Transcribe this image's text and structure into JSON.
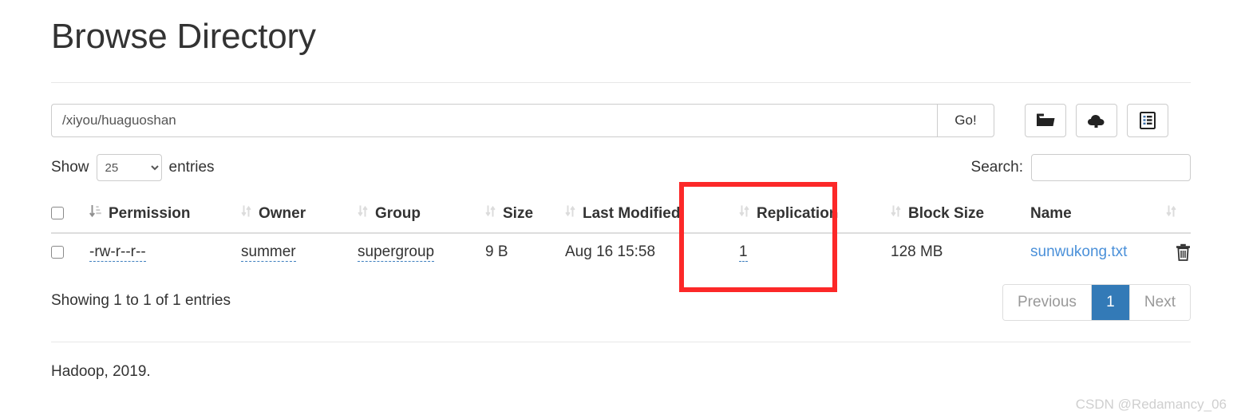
{
  "page": {
    "title": "Browse Directory"
  },
  "path_bar": {
    "value": "/xiyou/huaguoshan",
    "placeholder": "",
    "go_label": "Go!",
    "buttons": [
      {
        "name": "create-directory-button",
        "icon": "folder-open-icon"
      },
      {
        "name": "upload-files-button",
        "icon": "cloud-upload-icon"
      },
      {
        "name": "cut-paste-button",
        "icon": "clipboard-list-icon"
      }
    ]
  },
  "controls": {
    "show_label": "Show",
    "entries_label": "entries",
    "entries_value": "25",
    "entries_options": [
      "25"
    ],
    "search_label": "Search:",
    "search_value": "",
    "search_placeholder": ""
  },
  "table": {
    "columns": [
      {
        "key": "check",
        "label": ""
      },
      {
        "key": "permission",
        "label": "Permission"
      },
      {
        "key": "owner",
        "label": "Owner"
      },
      {
        "key": "group",
        "label": "Group"
      },
      {
        "key": "size",
        "label": "Size"
      },
      {
        "key": "modified",
        "label": "Last Modified"
      },
      {
        "key": "replication",
        "label": "Replication"
      },
      {
        "key": "blocksize",
        "label": "Block Size"
      },
      {
        "key": "name",
        "label": "Name"
      }
    ],
    "rows": [
      {
        "permission": "-rw-r--r--",
        "owner": "summer",
        "group": "supergroup",
        "size": "9 B",
        "modified": "Aug 16 15:58",
        "replication": "1",
        "blocksize": "128 MB",
        "name": "sunwukong.txt"
      }
    ]
  },
  "table_footer": {
    "showing_info": "Showing 1 to 1 of 1 entries",
    "pagination": {
      "previous_label": "Previous",
      "current_page": "1",
      "next_label": "Next"
    }
  },
  "footer": {
    "text": "Hadoop, 2019."
  },
  "watermark": {
    "text": "CSDN @Redamancy_06"
  },
  "colors": {
    "accent": "#337ab7",
    "link": "#4a90d9",
    "annotation": "#fc2828",
    "border": "#cccccc",
    "watermark": "#cfcfcf"
  }
}
